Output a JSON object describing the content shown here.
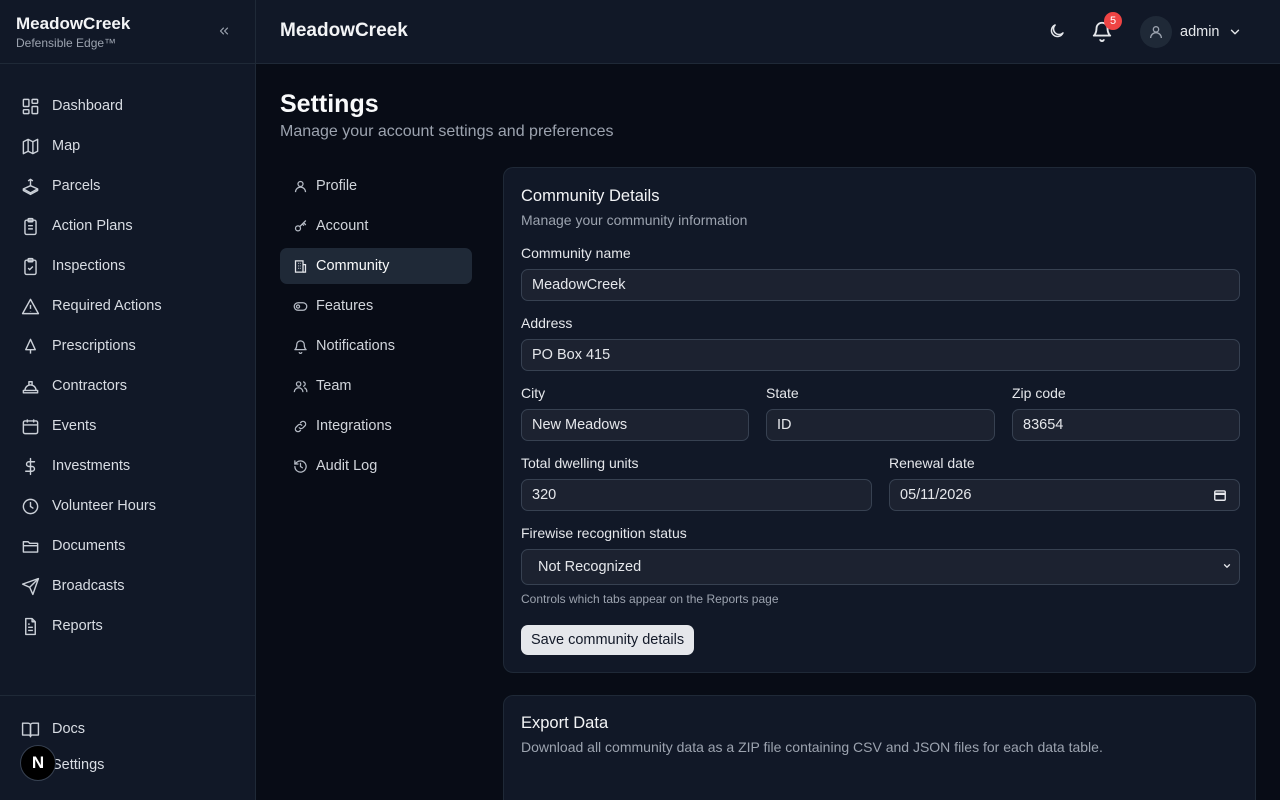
{
  "app": {
    "brand_title": "MeadowCreek",
    "brand_subtitle": "Defensible Edge™"
  },
  "sidebar": {
    "items": [
      {
        "label": "Dashboard",
        "icon": "dashboard-icon"
      },
      {
        "label": "Map",
        "icon": "map-icon"
      },
      {
        "label": "Parcels",
        "icon": "parcels-icon"
      },
      {
        "label": "Action Plans",
        "icon": "clipboard-icon"
      },
      {
        "label": "Inspections",
        "icon": "clipboard-check-icon"
      },
      {
        "label": "Required Actions",
        "icon": "alert-triangle-icon"
      },
      {
        "label": "Prescriptions",
        "icon": "tree-icon"
      },
      {
        "label": "Contractors",
        "icon": "hard-hat-icon"
      },
      {
        "label": "Events",
        "icon": "calendar-icon"
      },
      {
        "label": "Investments",
        "icon": "dollar-icon"
      },
      {
        "label": "Volunteer Hours",
        "icon": "clock-icon"
      },
      {
        "label": "Documents",
        "icon": "folder-icon"
      },
      {
        "label": "Broadcasts",
        "icon": "send-icon"
      },
      {
        "label": "Reports",
        "icon": "file-text-icon"
      }
    ],
    "bottom": [
      {
        "label": "Docs",
        "icon": "book-icon"
      },
      {
        "label": "Settings",
        "icon": "settings-icon"
      }
    ],
    "dev_badge": "N"
  },
  "header": {
    "title": "MeadowCreek",
    "notification_count": "5",
    "user_name": "admin"
  },
  "page": {
    "title": "Settings",
    "subtitle": "Manage your account settings and preferences"
  },
  "settings_nav": {
    "items": [
      {
        "label": "Profile",
        "icon": "user-icon"
      },
      {
        "label": "Account",
        "icon": "key-icon"
      },
      {
        "label": "Community",
        "icon": "building-icon",
        "active": true
      },
      {
        "label": "Features",
        "icon": "toggle-icon"
      },
      {
        "label": "Notifications",
        "icon": "bell-icon"
      },
      {
        "label": "Team",
        "icon": "users-icon"
      },
      {
        "label": "Integrations",
        "icon": "link-icon"
      },
      {
        "label": "Audit Log",
        "icon": "history-icon"
      }
    ]
  },
  "community": {
    "title": "Community Details",
    "description": "Manage your community information",
    "name_label": "Community name",
    "name_value": "MeadowCreek",
    "address_label": "Address",
    "address_value": "PO Box 415",
    "city_label": "City",
    "city_value": "New Meadows",
    "state_label": "State",
    "state_value": "ID",
    "zip_label": "Zip code",
    "zip_value": "83654",
    "units_label": "Total dwelling units",
    "units_value": "320",
    "renewal_label": "Renewal date",
    "renewal_value": "05/11/2026",
    "firewise_label": "Firewise recognition status",
    "firewise_value": "Not Recognized",
    "hint": "Controls which tabs appear on the Reports page",
    "save_label": "Save community details"
  },
  "export": {
    "title": "Export Data",
    "description": "Download all community data as a ZIP file containing CSV and JSON files for each data table."
  }
}
